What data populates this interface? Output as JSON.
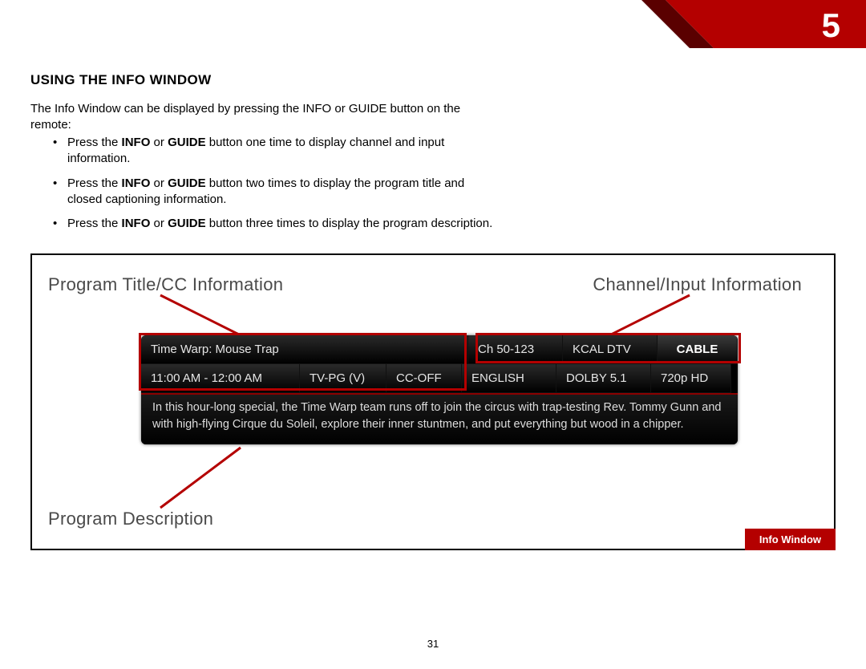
{
  "chapter": {
    "number": "5"
  },
  "heading": "USING THE INFO WINDOW",
  "intro": "The Info Window can be displayed by pressing the INFO or GUIDE button on the remote:",
  "bullets": [
    {
      "pre": "Press the ",
      "b1": "INFO",
      "mid": " or ",
      "b2": "GUIDE",
      "post": " button one time to display channel and input information."
    },
    {
      "pre": "Press the ",
      "b1": "INFO",
      "mid": " or ",
      "b2": "GUIDE",
      "post": " button two times to display the program title and closed captioning information."
    },
    {
      "pre": "Press the ",
      "b1": "INFO",
      "mid": " or ",
      "b2": "GUIDE",
      "post": " button three times to display the program description."
    }
  ],
  "callouts": {
    "title": "Program Title/CC Information",
    "channel": "Channel/Input Information",
    "desc": "Program Description"
  },
  "osd": {
    "row1": {
      "program": "Time Warp: Mouse Trap",
      "channel": "Ch 50-123",
      "station": "KCAL DTV",
      "input": "CABLE"
    },
    "row2": {
      "time": "11:00 AM - 12:00 AM",
      "rating": "TV-PG (V)",
      "cc": "CC-OFF",
      "lang": "ENGLISH",
      "audio": "DOLBY 5.1",
      "res": "720p HD"
    },
    "description": "In this hour-long special, the Time Warp team runs off to join the circus with trap-testing Rev. Tommy Gunn and with high-flying Cirque du Soleil, explore their inner stuntmen, and put everything but wood in a chipper."
  },
  "caption": "Info Window",
  "page_number": "31"
}
